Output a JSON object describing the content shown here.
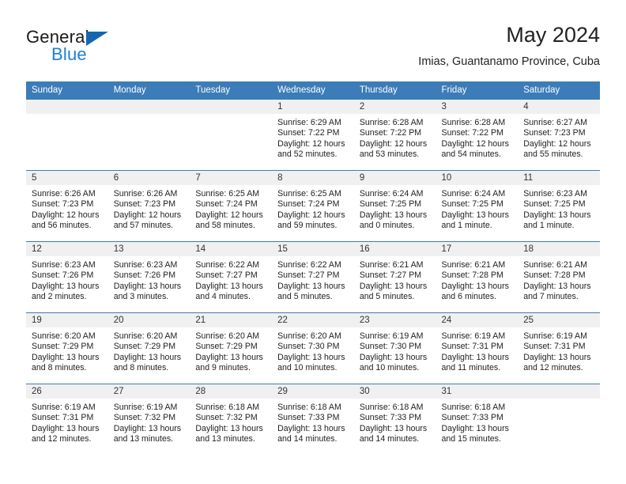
{
  "brand": {
    "name_part1": "General",
    "name_part2": "Blue",
    "logo_icon": "triangle-logo",
    "color_primary": "#1565b0",
    "color_accent": "#1c7fd6"
  },
  "header": {
    "month_title": "May 2024",
    "location": "Imias, Guantanamo Province, Cuba"
  },
  "theme": {
    "header_row_bg": "#3c7cb8",
    "daynum_bg": "#f0f0f0",
    "grid_line": "#3c7cb8",
    "text": "#222222"
  },
  "calendar": {
    "weekdays": [
      "Sunday",
      "Monday",
      "Tuesday",
      "Wednesday",
      "Thursday",
      "Friday",
      "Saturday"
    ],
    "weeks": [
      [
        {
          "day": "",
          "sunrise": "",
          "sunset": "",
          "daylight_line1": "",
          "daylight_line2": "",
          "empty": true
        },
        {
          "day": "",
          "sunrise": "",
          "sunset": "",
          "daylight_line1": "",
          "daylight_line2": "",
          "empty": true
        },
        {
          "day": "",
          "sunrise": "",
          "sunset": "",
          "daylight_line1": "",
          "daylight_line2": "",
          "empty": true
        },
        {
          "day": "1",
          "sunrise": "Sunrise: 6:29 AM",
          "sunset": "Sunset: 7:22 PM",
          "daylight_line1": "Daylight: 12 hours",
          "daylight_line2": "and 52 minutes.",
          "empty": false
        },
        {
          "day": "2",
          "sunrise": "Sunrise: 6:28 AM",
          "sunset": "Sunset: 7:22 PM",
          "daylight_line1": "Daylight: 12 hours",
          "daylight_line2": "and 53 minutes.",
          "empty": false
        },
        {
          "day": "3",
          "sunrise": "Sunrise: 6:28 AM",
          "sunset": "Sunset: 7:22 PM",
          "daylight_line1": "Daylight: 12 hours",
          "daylight_line2": "and 54 minutes.",
          "empty": false
        },
        {
          "day": "4",
          "sunrise": "Sunrise: 6:27 AM",
          "sunset": "Sunset: 7:23 PM",
          "daylight_line1": "Daylight: 12 hours",
          "daylight_line2": "and 55 minutes.",
          "empty": false
        }
      ],
      [
        {
          "day": "5",
          "sunrise": "Sunrise: 6:26 AM",
          "sunset": "Sunset: 7:23 PM",
          "daylight_line1": "Daylight: 12 hours",
          "daylight_line2": "and 56 minutes.",
          "empty": false
        },
        {
          "day": "6",
          "sunrise": "Sunrise: 6:26 AM",
          "sunset": "Sunset: 7:23 PM",
          "daylight_line1": "Daylight: 12 hours",
          "daylight_line2": "and 57 minutes.",
          "empty": false
        },
        {
          "day": "7",
          "sunrise": "Sunrise: 6:25 AM",
          "sunset": "Sunset: 7:24 PM",
          "daylight_line1": "Daylight: 12 hours",
          "daylight_line2": "and 58 minutes.",
          "empty": false
        },
        {
          "day": "8",
          "sunrise": "Sunrise: 6:25 AM",
          "sunset": "Sunset: 7:24 PM",
          "daylight_line1": "Daylight: 12 hours",
          "daylight_line2": "and 59 minutes.",
          "empty": false
        },
        {
          "day": "9",
          "sunrise": "Sunrise: 6:24 AM",
          "sunset": "Sunset: 7:25 PM",
          "daylight_line1": "Daylight: 13 hours",
          "daylight_line2": "and 0 minutes.",
          "empty": false
        },
        {
          "day": "10",
          "sunrise": "Sunrise: 6:24 AM",
          "sunset": "Sunset: 7:25 PM",
          "daylight_line1": "Daylight: 13 hours",
          "daylight_line2": "and 1 minute.",
          "empty": false
        },
        {
          "day": "11",
          "sunrise": "Sunrise: 6:23 AM",
          "sunset": "Sunset: 7:25 PM",
          "daylight_line1": "Daylight: 13 hours",
          "daylight_line2": "and 1 minute.",
          "empty": false
        }
      ],
      [
        {
          "day": "12",
          "sunrise": "Sunrise: 6:23 AM",
          "sunset": "Sunset: 7:26 PM",
          "daylight_line1": "Daylight: 13 hours",
          "daylight_line2": "and 2 minutes.",
          "empty": false
        },
        {
          "day": "13",
          "sunrise": "Sunrise: 6:23 AM",
          "sunset": "Sunset: 7:26 PM",
          "daylight_line1": "Daylight: 13 hours",
          "daylight_line2": "and 3 minutes.",
          "empty": false
        },
        {
          "day": "14",
          "sunrise": "Sunrise: 6:22 AM",
          "sunset": "Sunset: 7:27 PM",
          "daylight_line1": "Daylight: 13 hours",
          "daylight_line2": "and 4 minutes.",
          "empty": false
        },
        {
          "day": "15",
          "sunrise": "Sunrise: 6:22 AM",
          "sunset": "Sunset: 7:27 PM",
          "daylight_line1": "Daylight: 13 hours",
          "daylight_line2": "and 5 minutes.",
          "empty": false
        },
        {
          "day": "16",
          "sunrise": "Sunrise: 6:21 AM",
          "sunset": "Sunset: 7:27 PM",
          "daylight_line1": "Daylight: 13 hours",
          "daylight_line2": "and 5 minutes.",
          "empty": false
        },
        {
          "day": "17",
          "sunrise": "Sunrise: 6:21 AM",
          "sunset": "Sunset: 7:28 PM",
          "daylight_line1": "Daylight: 13 hours",
          "daylight_line2": "and 6 minutes.",
          "empty": false
        },
        {
          "day": "18",
          "sunrise": "Sunrise: 6:21 AM",
          "sunset": "Sunset: 7:28 PM",
          "daylight_line1": "Daylight: 13 hours",
          "daylight_line2": "and 7 minutes.",
          "empty": false
        }
      ],
      [
        {
          "day": "19",
          "sunrise": "Sunrise: 6:20 AM",
          "sunset": "Sunset: 7:29 PM",
          "daylight_line1": "Daylight: 13 hours",
          "daylight_line2": "and 8 minutes.",
          "empty": false
        },
        {
          "day": "20",
          "sunrise": "Sunrise: 6:20 AM",
          "sunset": "Sunset: 7:29 PM",
          "daylight_line1": "Daylight: 13 hours",
          "daylight_line2": "and 8 minutes.",
          "empty": false
        },
        {
          "day": "21",
          "sunrise": "Sunrise: 6:20 AM",
          "sunset": "Sunset: 7:29 PM",
          "daylight_line1": "Daylight: 13 hours",
          "daylight_line2": "and 9 minutes.",
          "empty": false
        },
        {
          "day": "22",
          "sunrise": "Sunrise: 6:20 AM",
          "sunset": "Sunset: 7:30 PM",
          "daylight_line1": "Daylight: 13 hours",
          "daylight_line2": "and 10 minutes.",
          "empty": false
        },
        {
          "day": "23",
          "sunrise": "Sunrise: 6:19 AM",
          "sunset": "Sunset: 7:30 PM",
          "daylight_line1": "Daylight: 13 hours",
          "daylight_line2": "and 10 minutes.",
          "empty": false
        },
        {
          "day": "24",
          "sunrise": "Sunrise: 6:19 AM",
          "sunset": "Sunset: 7:31 PM",
          "daylight_line1": "Daylight: 13 hours",
          "daylight_line2": "and 11 minutes.",
          "empty": false
        },
        {
          "day": "25",
          "sunrise": "Sunrise: 6:19 AM",
          "sunset": "Sunset: 7:31 PM",
          "daylight_line1": "Daylight: 13 hours",
          "daylight_line2": "and 12 minutes.",
          "empty": false
        }
      ],
      [
        {
          "day": "26",
          "sunrise": "Sunrise: 6:19 AM",
          "sunset": "Sunset: 7:31 PM",
          "daylight_line1": "Daylight: 13 hours",
          "daylight_line2": "and 12 minutes.",
          "empty": false
        },
        {
          "day": "27",
          "sunrise": "Sunrise: 6:19 AM",
          "sunset": "Sunset: 7:32 PM",
          "daylight_line1": "Daylight: 13 hours",
          "daylight_line2": "and 13 minutes.",
          "empty": false
        },
        {
          "day": "28",
          "sunrise": "Sunrise: 6:18 AM",
          "sunset": "Sunset: 7:32 PM",
          "daylight_line1": "Daylight: 13 hours",
          "daylight_line2": "and 13 minutes.",
          "empty": false
        },
        {
          "day": "29",
          "sunrise": "Sunrise: 6:18 AM",
          "sunset": "Sunset: 7:33 PM",
          "daylight_line1": "Daylight: 13 hours",
          "daylight_line2": "and 14 minutes.",
          "empty": false
        },
        {
          "day": "30",
          "sunrise": "Sunrise: 6:18 AM",
          "sunset": "Sunset: 7:33 PM",
          "daylight_line1": "Daylight: 13 hours",
          "daylight_line2": "and 14 minutes.",
          "empty": false
        },
        {
          "day": "31",
          "sunrise": "Sunrise: 6:18 AM",
          "sunset": "Sunset: 7:33 PM",
          "daylight_line1": "Daylight: 13 hours",
          "daylight_line2": "and 15 minutes.",
          "empty": false
        },
        {
          "day": "",
          "sunrise": "",
          "sunset": "",
          "daylight_line1": "",
          "daylight_line2": "",
          "empty": true
        }
      ]
    ]
  }
}
